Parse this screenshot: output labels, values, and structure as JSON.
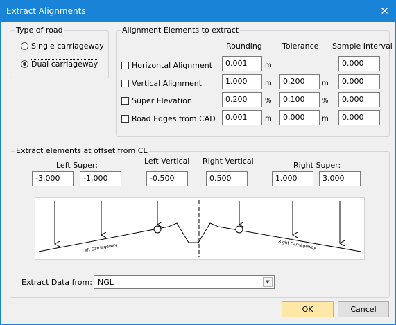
{
  "window": {
    "title": "Extract Alignments",
    "close_glyph": "✕"
  },
  "road_type": {
    "legend": "Type of road",
    "options": [
      {
        "label": "Single carriageway",
        "checked": false
      },
      {
        "label": "Dual carriageway",
        "checked": true
      }
    ]
  },
  "elements": {
    "legend": "Alignment Elements to extract",
    "headers": {
      "rounding": "Rounding",
      "tolerance": "Tolerance",
      "sample": "Sample Interval"
    },
    "rows": [
      {
        "label": "Horizontal Alignment",
        "checked": false,
        "rounding": "0.001",
        "rounding_unit": "m",
        "tolerance": "",
        "tolerance_unit": "",
        "sample": "0.000"
      },
      {
        "label": "Vertical Alignment",
        "checked": false,
        "rounding": "1.000",
        "rounding_unit": "m",
        "tolerance": "0.200",
        "tolerance_unit": "m",
        "sample": "0.000"
      },
      {
        "label": "Super Elevation",
        "checked": false,
        "rounding": "0.200",
        "rounding_unit": "%",
        "tolerance": "0.100",
        "tolerance_unit": "%",
        "sample": "0.000"
      },
      {
        "label": "Road Edges from CAD",
        "checked": false,
        "rounding": "0.001",
        "rounding_unit": "m",
        "tolerance": "0.000",
        "tolerance_unit": "m",
        "sample": "0.000"
      }
    ]
  },
  "offset": {
    "legend": "Extract elements at offset from CL",
    "left_super_label": "Left Super:",
    "left_vertical_label": "Left Vertical",
    "right_vertical_label": "Right Vertical",
    "right_super_label": "Right Super:",
    "left_super_values": [
      "-3.000",
      "-1.000"
    ],
    "left_vertical_value": "-0.500",
    "right_vertical_value": "0.500",
    "right_super_values": [
      "1.000",
      "3.000"
    ],
    "diagram": {
      "left_label": "Left Carriageway",
      "right_label": "Right Carriageway"
    },
    "extract_from_label": "Extract Data from:",
    "extract_from_value": "NGL"
  },
  "buttons": {
    "ok": "OK",
    "cancel": "Cancel"
  },
  "colors": {
    "titlebar": "#1883d7",
    "ok_button": "#ffe8a6",
    "dialog_bg": "#f0f0f0"
  }
}
